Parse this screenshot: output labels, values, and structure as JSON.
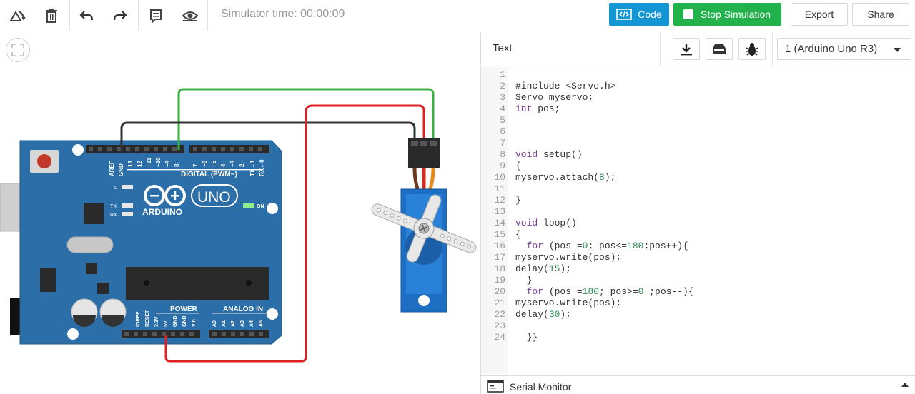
{
  "toolbar": {
    "simulator_time": "Simulator time: 00:00:09",
    "code_label": "Code",
    "stop_label": "Stop Simulation",
    "export_label": "Export",
    "share_label": "Share"
  },
  "panel": {
    "title": "Text",
    "device": "1 (Arduino Uno R3)",
    "serial_monitor": "Serial Monitor"
  },
  "board": {
    "brand": "ARDUINO",
    "model": "UNO",
    "digital_label": "DIGITAL (PWM~)",
    "power_label": "POWER",
    "analog_label": "ANALOG IN",
    "on_label": "ON",
    "l_label": "L",
    "tx_label": "TX",
    "rx_label": "RX",
    "top_pins": [
      "AREF",
      "GND",
      "13",
      "12",
      "~11",
      "~10",
      "~9",
      "8",
      "7",
      "~6",
      "~5",
      "4",
      "~3",
      "2",
      "TX→1",
      "RX←0"
    ],
    "bottom_pins": [
      "IOREF",
      "RESET",
      "3.3V",
      "5V",
      "GND",
      "GND",
      "Vin",
      "A0",
      "A1",
      "A2",
      "A3",
      "A4",
      "A5"
    ]
  },
  "code": {
    "lines": [
      {
        "n": "1",
        "t": ""
      },
      {
        "n": "2",
        "t": "#include <Servo.h>"
      },
      {
        "n": "3",
        "t": "Servo myservo;"
      },
      {
        "n": "4",
        "t": "int pos;"
      },
      {
        "n": "5",
        "t": ""
      },
      {
        "n": "6",
        "t": ""
      },
      {
        "n": "7",
        "t": ""
      },
      {
        "n": "8",
        "t": "void setup()"
      },
      {
        "n": "9",
        "t": "{"
      },
      {
        "n": "10",
        "t": "myservo.attach(8);"
      },
      {
        "n": "11",
        "t": ""
      },
      {
        "n": "12",
        "t": "}"
      },
      {
        "n": "13",
        "t": ""
      },
      {
        "n": "14",
        "t": "void loop()"
      },
      {
        "n": "15",
        "t": "{"
      },
      {
        "n": "16",
        "t": "  for (pos =0; pos<=180;pos++){"
      },
      {
        "n": "17",
        "t": "myservo.write(pos);"
      },
      {
        "n": "18",
        "t": "delay(15);"
      },
      {
        "n": "19",
        "t": "  }"
      },
      {
        "n": "20",
        "t": "  for (pos =180; pos>=0 ;pos--){"
      },
      {
        "n": "21",
        "t": "myservo.write(pos);"
      },
      {
        "n": "22",
        "t": "delay(30);"
      },
      {
        "n": "23",
        "t": ""
      },
      {
        "n": "24",
        "t": "  }}"
      }
    ]
  },
  "colors": {
    "code_button": "#1596d4",
    "stop_button": "#22b24c",
    "board": "#2b6ea8",
    "wire_green": "#3cb043",
    "wire_red": "#e02020",
    "wire_black": "#333333",
    "servo": "#1e6fc4"
  },
  "icons": [
    "rotate-icon",
    "trash-icon",
    "undo-icon",
    "redo-icon",
    "notes-icon",
    "eye-icon",
    "fit-icon",
    "code-icon",
    "download-icon",
    "upload-icon",
    "bug-icon",
    "serial-monitor-icon"
  ]
}
